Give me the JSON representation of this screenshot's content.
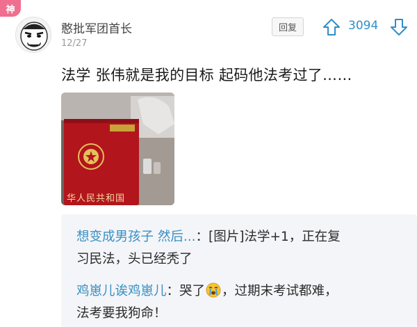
{
  "badge": {
    "label": "神"
  },
  "comment": {
    "username": "憨批军团首长",
    "date": "12/27",
    "reply_label": "回复",
    "score": "3094",
    "text": "法学 张伟就是我的目标 起码他法考过了……",
    "image": {
      "cover_text": "华人民共和国",
      "cover_color": "#b3151d"
    }
  },
  "replies": [
    {
      "author": "想变成男孩子 然后...",
      "separator": "：",
      "text_line1": "[图片]法学+1，正在复",
      "text_line2": "习民法，头已经秃了"
    },
    {
      "author": "鸡崽儿诶鸡崽儿",
      "separator": "：",
      "text_before_emoji": "哭了",
      "emoji": "crying-face-icon",
      "text_after_emoji": "，过期末考试都难，",
      "text_line2": "法考要我狗命！"
    }
  ],
  "colors": {
    "accent": "#2f8fc8",
    "author_link": "#3a8fc4",
    "badge": "#f06e8f",
    "quote_bg": "#f3f5f8"
  }
}
